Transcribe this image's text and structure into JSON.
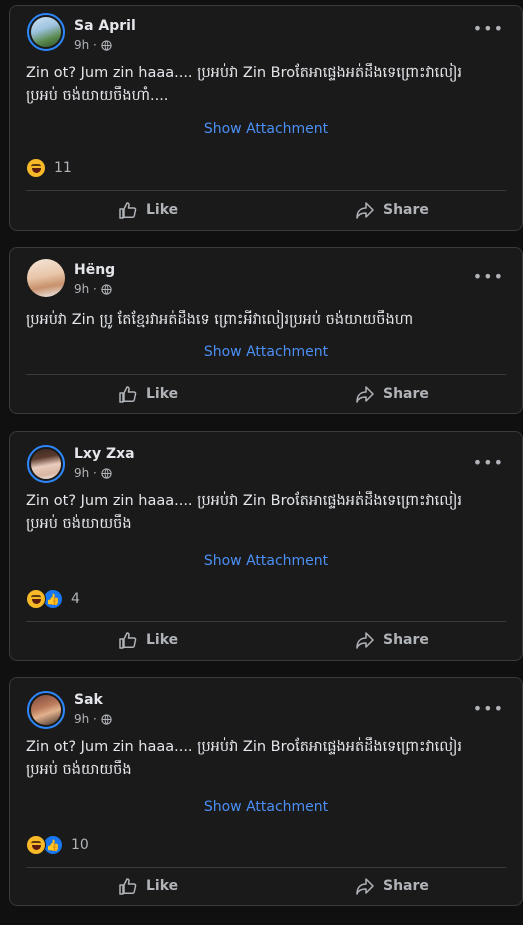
{
  "posts": [
    {
      "author": "Sa April",
      "time": "9h ·",
      "text_line1": "Zin ot? Jum zin haaa.... ប្រអប់វា Zin Broតែអាផ្ទេងអត់ដឹងទេព្រោះវាលៀរ",
      "text_line2": "ប្រអប់ ចង់យាយចឹងហាំ....",
      "attachment": "Show Attachment",
      "reactions": [
        "haha"
      ],
      "reaction_count": "11",
      "like": "Like",
      "share": "Share"
    },
    {
      "author": "Hëng",
      "time": "9h ·",
      "text_line1": "ប្រអប់វា Zin ប្រូ តែខ្មែរវាអត់ដឹងទេ ព្រោះអីវាលៀរប្រអប់ ចង់យាយចឹងហា",
      "text_line2": "",
      "attachment": "Show Attachment",
      "reactions": [],
      "reaction_count": "",
      "like": "Like",
      "share": "Share"
    },
    {
      "author": "Lxy Zxa",
      "time": "9h ·",
      "text_line1": "Zin ot? Jum zin haaa.... ប្រអប់វា Zin Broតែអាផ្ទេងអត់ដឹងទេព្រោះវាលៀរ",
      "text_line2": "ប្រអប់ ចង់យាយចឹង",
      "attachment": "Show Attachment",
      "reactions": [
        "haha",
        "like"
      ],
      "reaction_count": "4",
      "like": "Like",
      "share": "Share"
    },
    {
      "author": "Sak",
      "time": "9h ·",
      "text_line1": "Zin ot? Jum zin haaa.... ប្រអប់វា Zin Broតែអាផ្ទេងអត់ដឹងទេព្រោះវាលៀរ",
      "text_line2": "ប្រអប់ ចង់យាយចឹង",
      "attachment": "Show Attachment",
      "reactions": [
        "haha",
        "like"
      ],
      "reaction_count": "10",
      "like": "Like",
      "share": "Share"
    }
  ],
  "colors": {
    "accent": "#4b8ff5",
    "like_blue": "#1877f2",
    "haha_yellow": "#f7b928"
  },
  "icons": [
    "more-options-icon",
    "globe-icon",
    "like-thumb-icon",
    "share-arrow-icon",
    "haha-reaction-icon",
    "like-reaction-icon"
  ]
}
